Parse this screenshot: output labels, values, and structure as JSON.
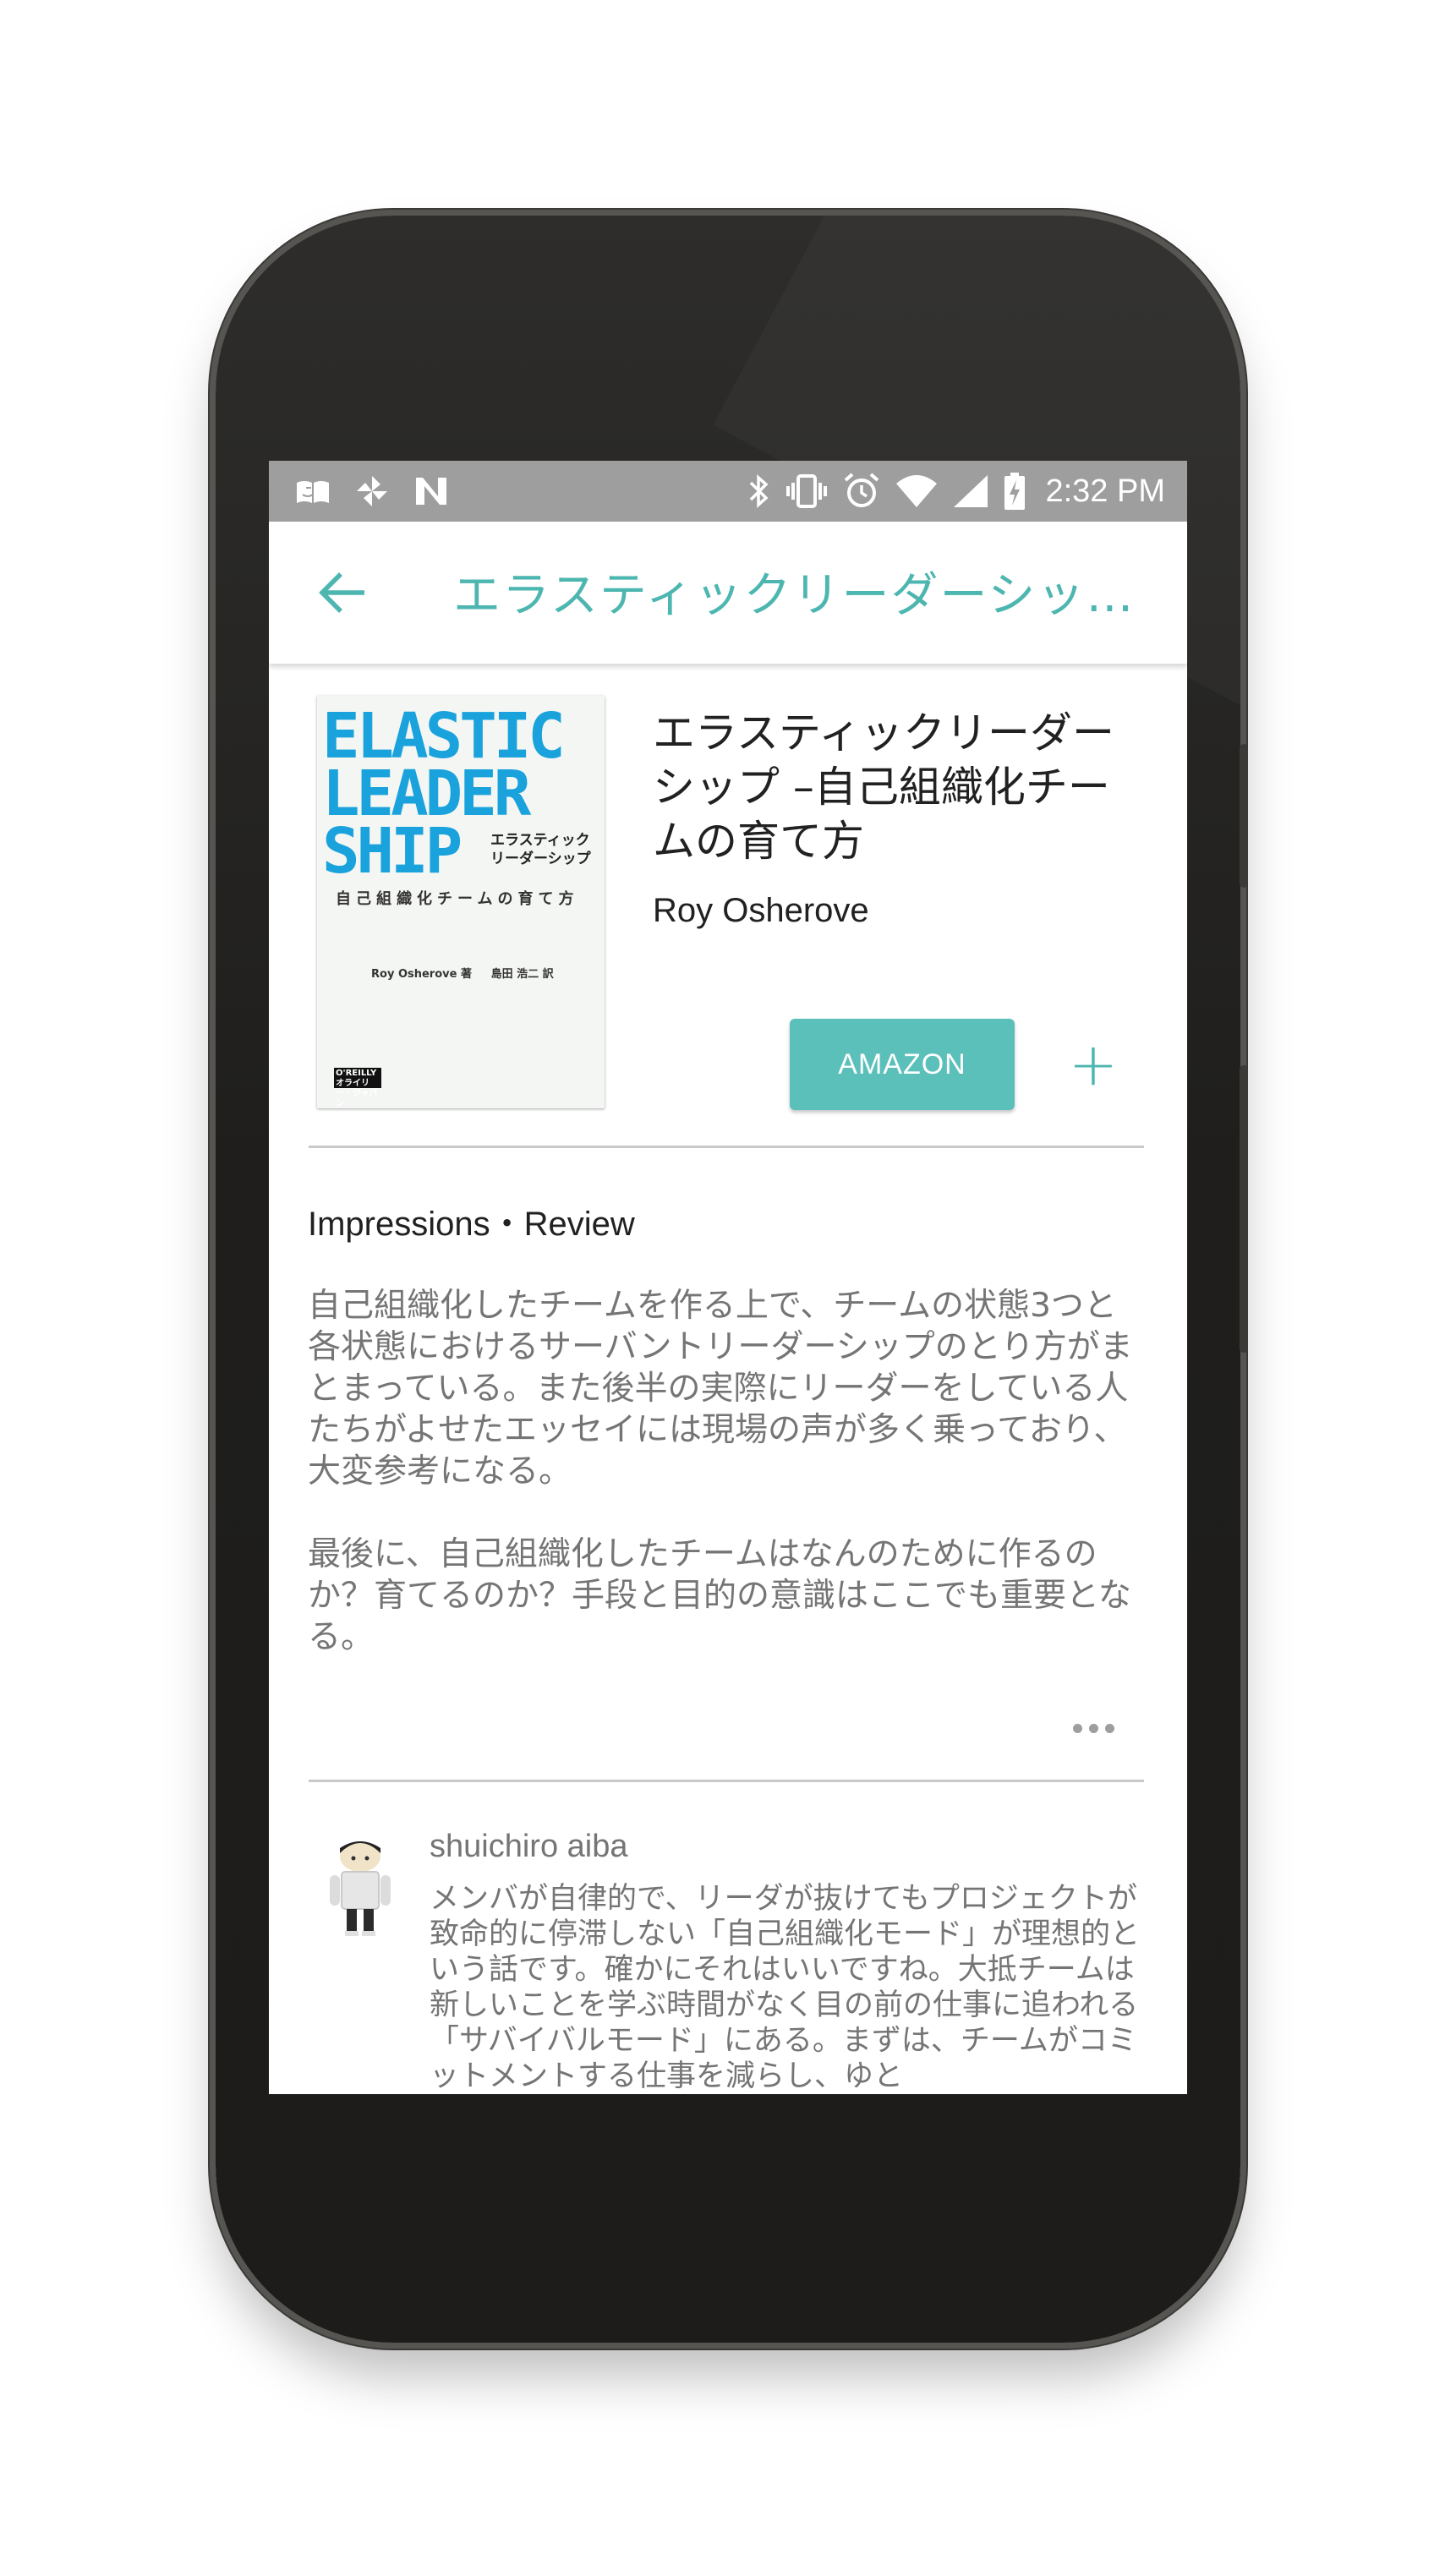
{
  "status_bar": {
    "time": "2:32 PM",
    "left_icons": [
      "amazon-kindle-icon",
      "pinwheel-icon",
      "notification-n-icon"
    ],
    "right_icons": [
      "bluetooth-icon",
      "vibrate-icon",
      "alarm-icon",
      "wifi-icon",
      "signal-icon",
      "battery-charging-icon"
    ]
  },
  "app_bar": {
    "back_icon": "arrow-back-icon",
    "title": "エラスティックリーダーシップ –自己組織化チームの育て方"
  },
  "book": {
    "title": "エラスティックリーダーシップ –自己組織化チームの育て方",
    "author": "Roy Osherove",
    "cover": {
      "title": "ELASTIC\nLEADER\nSHIP",
      "jp_title": "エラスティック\nリーダーシップ",
      "subtitle": "自己組織化チームの育て方",
      "authors": "Roy Osherove 著     島田 浩二 訳",
      "publisher": "O'REILLY オライリー・ジャパン"
    },
    "amazon_label": "AMAZON",
    "add_icon": "+"
  },
  "review_section": {
    "label": "Impressions・Review",
    "paragraphs": [
      "自己組織化したチームを作る上で、チームの状態3つと各状態におけるサーバントリーダーシップのとり方がまとまっている。また後半の実際にリーダーをしている人たちがよせたエッセイには現場の声が多く乗っており、大変参考になる。",
      "最後に、自己組織化したチームはなんのために作るのか？育てるのか？手段と目的の意識はここでも重要となる。"
    ],
    "more_icon": "more-horizontal-icon"
  },
  "comment": {
    "user": "shuichiro aiba",
    "text": "メンバが自律的で、リーダが抜けてもプロジェクトが致命的に停滞しない「自己組織化モード」が理想的という話です。確かにそれはいいですね。大抵チームは新しいことを学ぶ時間がなく目の前の仕事に追われる「サバイバルモード」にある。まずは、チームがコミットメントする仕事を減らし、ゆと"
  },
  "colors": {
    "accent": "#4db6b0",
    "amazon_button": "#5cc0ba",
    "status_bar": "#9e9e9e",
    "phone_body": "#2a2927",
    "body_text": "#757575"
  }
}
